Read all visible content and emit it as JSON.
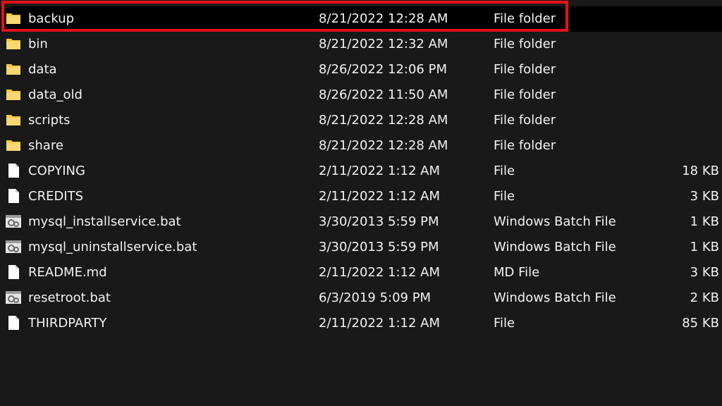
{
  "accent": {
    "highlight": "#e3101a",
    "folder": "#f2c94c"
  },
  "files": [
    {
      "name": "backup",
      "date": "8/21/2022 12:28 AM",
      "type": "File folder",
      "size": "",
      "icon": "folder-icon"
    },
    {
      "name": "bin",
      "date": "8/21/2022 12:32 AM",
      "type": "File folder",
      "size": "",
      "icon": "folder-icon"
    },
    {
      "name": "data",
      "date": "8/26/2022 12:06 PM",
      "type": "File folder",
      "size": "",
      "icon": "folder-icon"
    },
    {
      "name": "data_old",
      "date": "8/26/2022 11:50 AM",
      "type": "File folder",
      "size": "",
      "icon": "folder-icon"
    },
    {
      "name": "scripts",
      "date": "8/21/2022 12:28 AM",
      "type": "File folder",
      "size": "",
      "icon": "folder-icon"
    },
    {
      "name": "share",
      "date": "8/21/2022 12:28 AM",
      "type": "File folder",
      "size": "",
      "icon": "folder-icon"
    },
    {
      "name": "COPYING",
      "date": "2/11/2022 1:12 AM",
      "type": "File",
      "size": "18 KB",
      "icon": "file-icon"
    },
    {
      "name": "CREDITS",
      "date": "2/11/2022 1:12 AM",
      "type": "File",
      "size": "3 KB",
      "icon": "file-icon"
    },
    {
      "name": "mysql_installservice.bat",
      "date": "3/30/2013 5:59 PM",
      "type": "Windows Batch File",
      "size": "1 KB",
      "icon": "batch-file-icon"
    },
    {
      "name": "mysql_uninstallservice.bat",
      "date": "3/30/2013 5:59 PM",
      "type": "Windows Batch File",
      "size": "1 KB",
      "icon": "batch-file-icon"
    },
    {
      "name": "README.md",
      "date": "2/11/2022 1:12 AM",
      "type": "MD File",
      "size": "3 KB",
      "icon": "file-icon"
    },
    {
      "name": "resetroot.bat",
      "date": "6/3/2019 5:09 PM",
      "type": "Windows Batch File",
      "size": "2 KB",
      "icon": "batch-file-icon"
    },
    {
      "name": "THIRDPARTY",
      "date": "2/11/2022 1:12 AM",
      "type": "File",
      "size": "85 KB",
      "icon": "file-icon"
    }
  ]
}
